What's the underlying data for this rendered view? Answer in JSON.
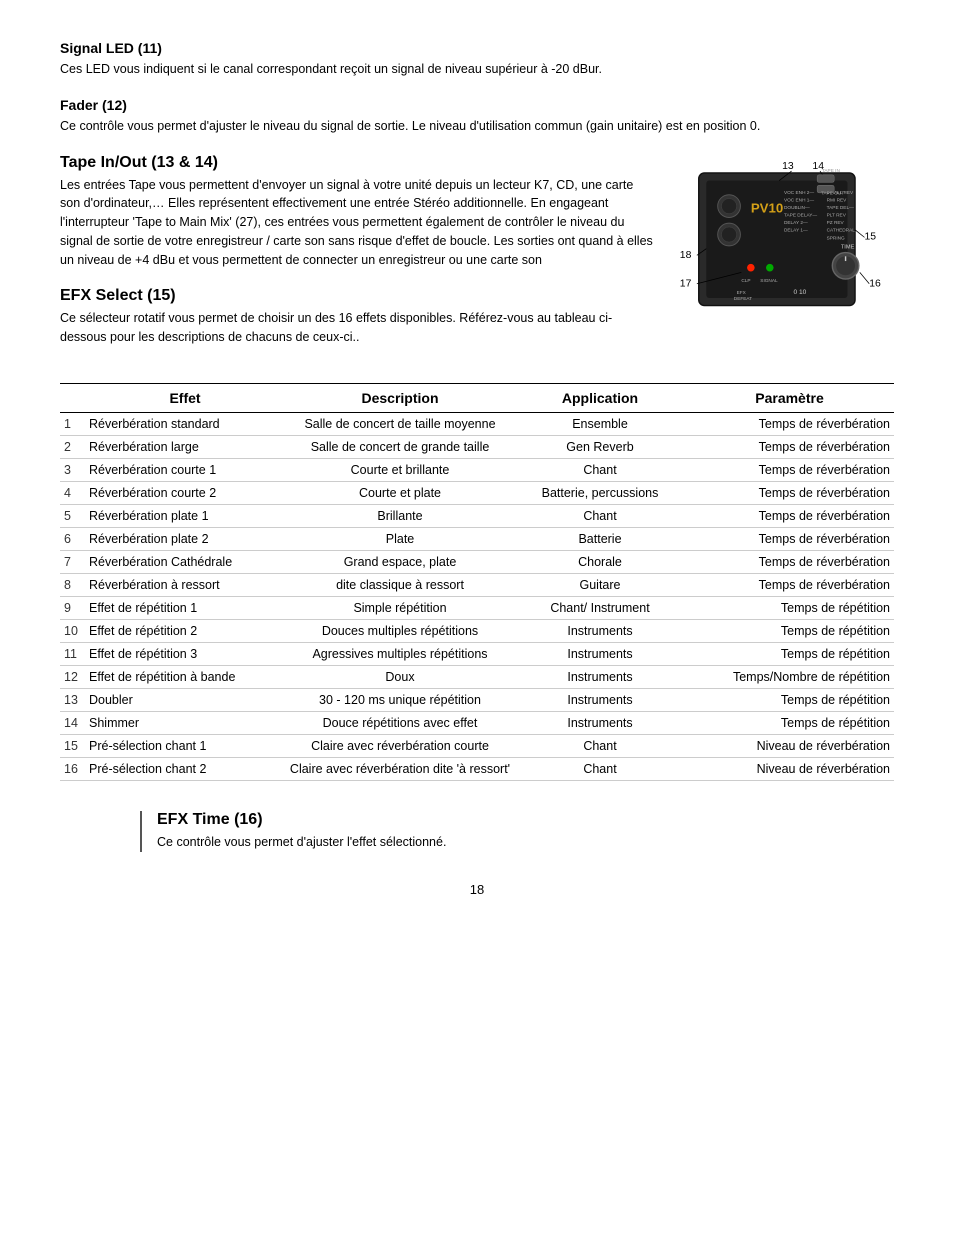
{
  "sections": {
    "signal_led": {
      "title": "Signal LED (11)",
      "body": "Ces LED vous indiquent si le canal correspondant reçoit un signal  de niveau supérieur à -20 dBur."
    },
    "fader": {
      "title": "Fader (12)",
      "body": "Ce contrôle vous permet d'ajuster le niveau du signal de sortie. Le niveau d'utilisation commun (gain unitaire) est en position 0."
    },
    "tape_in_out": {
      "title": "Tape In/Out (13 & 14)",
      "body": "Les entrées Tape vous permettent d'envoyer un signal à votre unité depuis un lecteur K7, CD, une carte son d'ordinateur,… Elles représentent effectivement une entrée Stéréo additionnelle. En engageant l'interrupteur 'Tape to Main Mix' (27), ces entrées vous permettent également de contrôler le niveau du signal de sortie de votre enregistreur / carte son sans risque d'effet de boucle. Les sorties ont quand à elles un niveau de +4 dBu et vous permettent de connecter un enregistreur ou une carte son"
    },
    "efx_select": {
      "title": "EFX Select (15)",
      "body": "Ce sélecteur rotatif vous permet de choisir un des 16 effets disponibles. Référez-vous au tableau ci-dessous pour les descriptions de chacuns de ceux-ci.."
    },
    "efx_time": {
      "title": "EFX Time (16)",
      "body": "Ce contrôle vous permet d'ajuster l'effet sélectionné."
    }
  },
  "table": {
    "headers": [
      "",
      "Effet",
      "Description",
      "Application",
      "Paramètre"
    ],
    "rows": [
      [
        "1",
        "Réverbération standard",
        "Salle de concert de taille moyenne",
        "Ensemble",
        "Temps de réverbération"
      ],
      [
        "2",
        "Réverbération large",
        "Salle de concert de grande taille",
        "Gen Reverb",
        "Temps de réverbération"
      ],
      [
        "3",
        "Réverbération courte 1",
        "Courte et brillante",
        "Chant",
        "Temps de réverbération"
      ],
      [
        "4",
        "Réverbération courte 2",
        "Courte et plate",
        "Batterie, percussions",
        "Temps de réverbération"
      ],
      [
        "5",
        "Réverbération plate 1",
        "Brillante",
        "Chant",
        "Temps de réverbération"
      ],
      [
        "6",
        "Réverbération plate 2",
        "Plate",
        "Batterie",
        "Temps de réverbération"
      ],
      [
        "7",
        "Réverbération Cathédrale",
        "Grand espace, plate",
        "Chorale",
        "Temps de réverbération"
      ],
      [
        "8",
        "Réverbération à ressort",
        "dite classique à ressort",
        "Guitare",
        "Temps de réverbération"
      ],
      [
        "9",
        "Effet de répétition 1",
        "Simple répétition",
        "Chant/ Instrument",
        "Temps de répétition"
      ],
      [
        "10",
        "Effet de répétition 2",
        "Douces multiples répétitions",
        "Instruments",
        "Temps de répétition"
      ],
      [
        "11",
        "Effet de répétition 3",
        "Agressives multiples répétitions",
        "Instruments",
        "Temps de répétition"
      ],
      [
        "12",
        "Effet de répétition à bande",
        "Doux",
        "Instruments",
        "Temps/Nombre de répétition"
      ],
      [
        "13",
        "Doubler",
        "30 - 120 ms unique répétition",
        "Instruments",
        "Temps de répétition"
      ],
      [
        "14",
        "Shimmer",
        "Douce répétitions avec effet",
        "Instruments",
        "Temps de répétition"
      ],
      [
        "15",
        "Pré-sélection chant 1",
        "Claire avec réverbération courte",
        "Chant",
        "Niveau de réverbération"
      ],
      [
        "16",
        "Pré-sélection chant 2",
        "Claire avec réverbération dite 'à ressort'",
        "Chant",
        "Niveau de réverbération"
      ]
    ]
  },
  "page_number": "18"
}
